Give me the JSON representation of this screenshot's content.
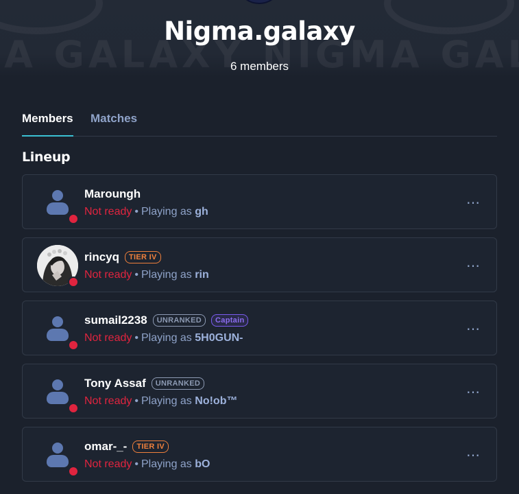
{
  "header": {
    "team_name": "Nigma.galaxy",
    "member_count": "6 members",
    "watermark": "IA GALAXY   NIGMA GAL"
  },
  "tabs": [
    {
      "label": "Members",
      "active": true
    },
    {
      "label": "Matches",
      "active": false
    }
  ],
  "section": {
    "title": "Lineup"
  },
  "members": [
    {
      "name": "Maroungh",
      "badges": [],
      "status": "Not ready",
      "playing_prefix": "Playing as",
      "playing_as": "gh",
      "avatar": "default-avatar-icon"
    },
    {
      "name": "rincyq",
      "badges": [
        {
          "label": "TIER IV",
          "type": "tier"
        }
      ],
      "status": "Not ready",
      "playing_prefix": "Playing as",
      "playing_as": "rin",
      "avatar": "photo"
    },
    {
      "name": "sumail2238",
      "badges": [
        {
          "label": "UNRANKED",
          "type": "unranked"
        },
        {
          "label": "Captain",
          "type": "captain"
        }
      ],
      "status": "Not ready",
      "playing_prefix": "Playing as",
      "playing_as": "5H0GUN-",
      "avatar": "default-avatar-icon"
    },
    {
      "name": "Tony Assaf",
      "badges": [
        {
          "label": "UNRANKED",
          "type": "unranked"
        }
      ],
      "status": "Not ready",
      "playing_prefix": "Playing as",
      "playing_as": "No!ob™",
      "avatar": "default-avatar-icon"
    },
    {
      "name": "omar-_-",
      "badges": [
        {
          "label": "TIER IV",
          "type": "tier"
        }
      ],
      "status": "Not ready",
      "playing_prefix": "Playing as",
      "playing_as": "bO",
      "avatar": "default-avatar-icon"
    }
  ],
  "more_icon": "⋯",
  "colors": {
    "background": "#1b212c",
    "card_border": "#323a48",
    "accent_tab": "#3bc1d3",
    "status_red": "#e0243f",
    "tier_orange": "#f0803c",
    "captain_purple": "#7b5cf0",
    "muted_blue": "#8fa3c9"
  }
}
